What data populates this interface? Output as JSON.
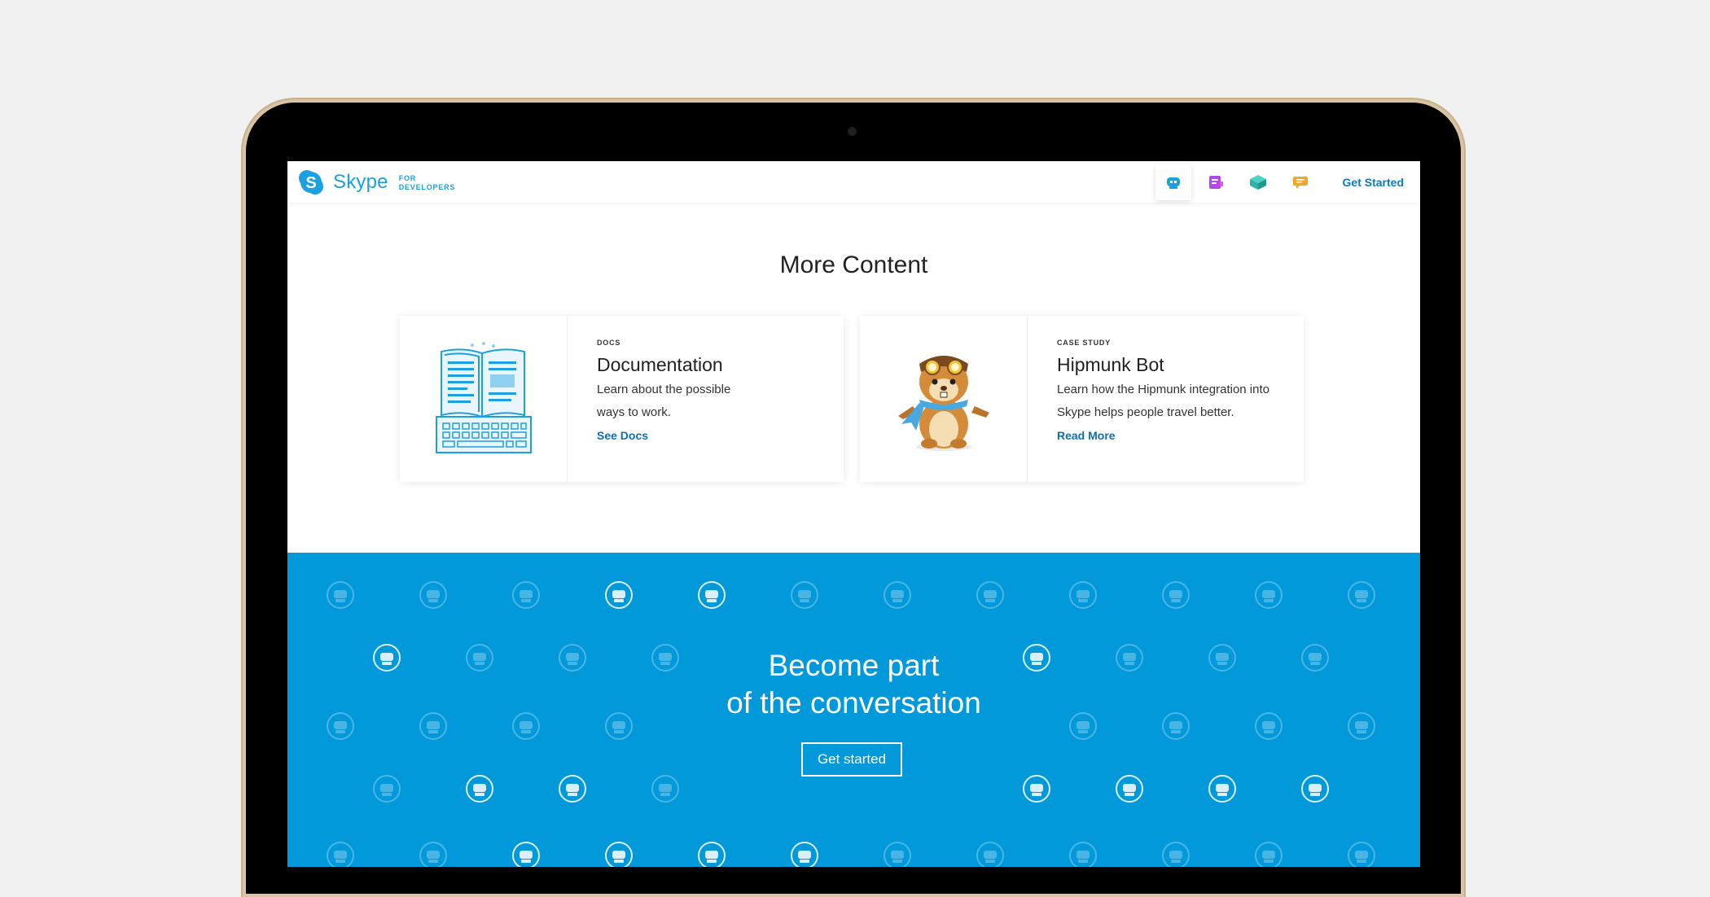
{
  "header": {
    "brand_name": "Skype",
    "brand_sub_line1": "FOR",
    "brand_sub_line2": "DEVELOPERS",
    "nav_icons": [
      "bot-icon",
      "notebook-icon",
      "cube-icon",
      "chat-icon"
    ],
    "cta": "Get Started"
  },
  "main": {
    "title": "More Content",
    "cards": [
      {
        "eyebrow": "DOCS",
        "title": "Documentation",
        "desc_line1": "Learn about the possible",
        "desc_line2": "ways to work.",
        "link": "See Docs",
        "art": "book-keyboard-illustration"
      },
      {
        "eyebrow": "CASE STUDY",
        "title": "Hipmunk Bot",
        "desc_line1": "Learn how the Hipmunk integration into",
        "desc_line2": "Skype helps people travel better.",
        "link": "Read More",
        "art": "hipmunk-chipmunk-illustration"
      }
    ]
  },
  "cta_band": {
    "title_line1": "Become part",
    "title_line2": "of the conversation",
    "button": "Get started"
  },
  "colors": {
    "brand": "#1ba0e1",
    "band": "#0299da",
    "link": "#0b6fb8"
  }
}
